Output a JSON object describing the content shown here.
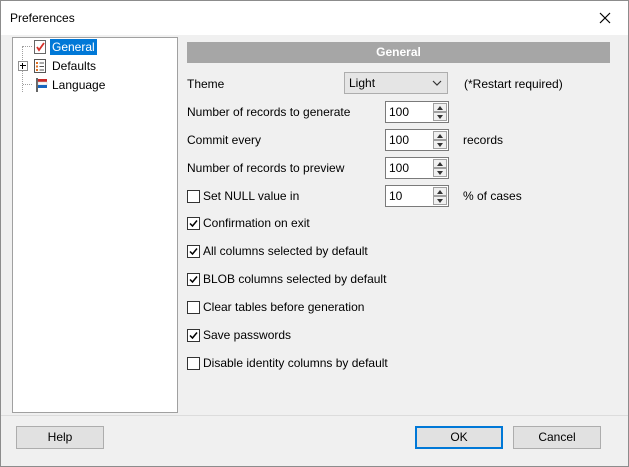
{
  "window": {
    "title": "Preferences"
  },
  "tree": {
    "items": [
      {
        "label": "General",
        "selected": true,
        "icon": "checklist-icon"
      },
      {
        "label": "Defaults",
        "selected": false,
        "icon": "list-icon",
        "expandable": true
      },
      {
        "label": "Language",
        "selected": false,
        "icon": "flag-icon"
      }
    ]
  },
  "panel": {
    "header": "General",
    "theme": {
      "label": "Theme",
      "value": "Light",
      "note": "(*Restart required)"
    },
    "records_to_generate": {
      "label": "Number of records to generate",
      "value": "100"
    },
    "commit_every": {
      "label": "Commit every",
      "value": "100",
      "suffix": "records"
    },
    "records_to_preview": {
      "label": "Number of records to preview",
      "value": "100"
    },
    "set_null": {
      "label": "Set NULL value in",
      "checked": false,
      "value": "10",
      "suffix": "% of cases"
    },
    "checkboxes": [
      {
        "label": "Confirmation on exit",
        "checked": true
      },
      {
        "label": "All columns selected by default",
        "checked": true
      },
      {
        "label": "BLOB columns selected by default",
        "checked": true
      },
      {
        "label": "Clear tables before generation",
        "checked": false
      },
      {
        "label": "Save passwords",
        "checked": true
      },
      {
        "label": "Disable identity columns by default",
        "checked": false
      }
    ]
  },
  "buttons": {
    "help": "Help",
    "ok": "OK",
    "cancel": "Cancel"
  },
  "colors": {
    "selection": "#0078d7",
    "header_bar": "#a6a6a6"
  }
}
